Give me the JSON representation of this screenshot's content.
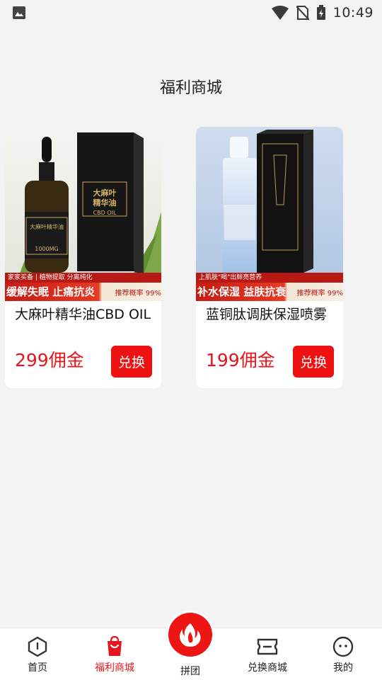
{
  "status_bar": {
    "time": "10:49"
  },
  "page": {
    "title": "福利商城"
  },
  "products": [
    {
      "name": "大麻叶精华油CBD OIL",
      "price": "299佣金",
      "button": "兑换",
      "banner_top": "家家买备 | 植物提取 分离纯化",
      "banner_slogan": "缓解失眠  止痛抗炎",
      "banner_rate": "推荐概率 99%"
    },
    {
      "name": "蓝铜肽调肤保湿喷雾",
      "price": "199佣金",
      "button": "兑换",
      "banner_top": "上肌肤\"喝\"出鲜亮营养",
      "banner_slogan": "补水保湿  益肤抗衰",
      "banner_rate": "推荐概率 99%"
    }
  ],
  "tabbar": {
    "home": "首页",
    "welfare": "福利商城",
    "group": "拼团",
    "exchange": "兑换商城",
    "mine": "我的"
  },
  "colors": {
    "accent": "#e8141b",
    "background": "#f3f3f3"
  }
}
